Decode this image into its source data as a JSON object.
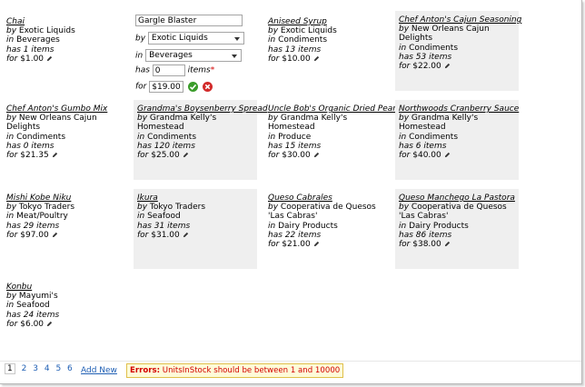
{
  "labels": {
    "by": "by",
    "in": "in",
    "has": "has",
    "items": "items",
    "for": "for",
    "required_mark": "*"
  },
  "products": [
    {
      "name": "Chai",
      "supplier": "Exotic Liquids",
      "category": "Beverages",
      "units": "1",
      "price": "$1.00"
    },
    {
      "name": "Aniseed Syrup",
      "supplier": "Exotic Liquids",
      "category": "Condiments",
      "units": "13",
      "price": "$10.00"
    },
    {
      "name": "Chef Anton's Cajun Seasoning",
      "supplier": "New Orleans Cajun Delights",
      "category": "Condiments",
      "units": "53",
      "price": "$22.00"
    },
    {
      "name": "Chef Anton's Gumbo Mix",
      "supplier": "New Orleans Cajun Delights",
      "category": "Condiments",
      "units": "0",
      "price": "$21.35"
    },
    {
      "name": "Grandma's Boysenberry Spread",
      "supplier": "Grandma Kelly's Homestead",
      "category": "Condiments",
      "units": "120",
      "price": "$25.00"
    },
    {
      "name": "Uncle Bob's Organic Dried Pears",
      "supplier": "Grandma Kelly's Homestead",
      "category": "Produce",
      "units": "15",
      "price": "$30.00"
    },
    {
      "name": "Northwoods Cranberry Sauce",
      "supplier": "Grandma Kelly's Homestead",
      "category": "Condiments",
      "units": "6",
      "price": "$40.00"
    },
    {
      "name": "Mishi Kobe Niku",
      "supplier": "Tokyo Traders",
      "category": "Meat/Poultry",
      "units": "29",
      "price": "$97.00"
    },
    {
      "name": "Ikura",
      "supplier": "Tokyo Traders",
      "category": "Seafood",
      "units": "31",
      "price": "$31.00"
    },
    {
      "name": "Queso Cabrales",
      "supplier": "Cooperativa de Quesos 'Las Cabras'",
      "category": "Dairy Products",
      "units": "22",
      "price": "$21.00"
    },
    {
      "name": "Queso Manchego La Pastora",
      "supplier": "Cooperativa de Quesos 'Las Cabras'",
      "category": "Dairy Products",
      "units": "86",
      "price": "$38.00"
    },
    {
      "name": "Konbu",
      "supplier": "Mayumi's",
      "category": "Seafood",
      "units": "24",
      "price": "$6.00"
    }
  ],
  "edit_form": {
    "name_value": "Gargle Blaster",
    "supplier_selected": "Exotic Liquids",
    "category_selected": "Beverages",
    "units_value": "0",
    "price_value": "$19.00"
  },
  "pager": {
    "current": "1",
    "pages": [
      "2",
      "3",
      "4",
      "5",
      "6"
    ],
    "add_new": "Add New"
  },
  "errors": {
    "label": "Errors:",
    "message": "UnitsInStock should be between 1 and 10000"
  },
  "colors": {
    "card_alt_bg": "#efefef",
    "link": "#1f5fb4",
    "error_text": "#d40000",
    "error_bg": "#fdfbd8"
  }
}
